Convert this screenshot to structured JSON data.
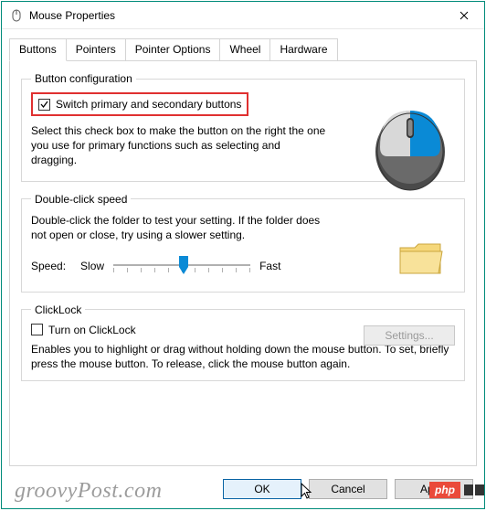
{
  "window": {
    "title": "Mouse Properties"
  },
  "tabs": {
    "items": [
      {
        "label": "Buttons",
        "active": true
      },
      {
        "label": "Pointers",
        "active": false
      },
      {
        "label": "Pointer Options",
        "active": false
      },
      {
        "label": "Wheel",
        "active": false
      },
      {
        "label": "Hardware",
        "active": false
      }
    ]
  },
  "button_config": {
    "legend": "Button configuration",
    "switch_label": "Switch primary and secondary buttons",
    "switch_checked": true,
    "help": "Select this check box to make the button on the right the one you use for primary functions such as selecting and dragging."
  },
  "double_click": {
    "legend": "Double-click speed",
    "help": "Double-click the folder to test your setting. If the folder does not open or close, try using a slower setting.",
    "speed_label": "Speed:",
    "slow_label": "Slow",
    "fast_label": "Fast"
  },
  "clicklock": {
    "legend": "ClickLock",
    "toggle_label": "Turn on ClickLock",
    "toggle_checked": false,
    "settings_label": "Settings...",
    "help": "Enables you to highlight or drag without holding down the mouse button. To set, briefly press the mouse button. To release, click the mouse button again."
  },
  "buttons": {
    "ok": "OK",
    "cancel": "Cancel",
    "apply": "Apply"
  },
  "watermark": "groovyPost.com",
  "php_badge": "php"
}
